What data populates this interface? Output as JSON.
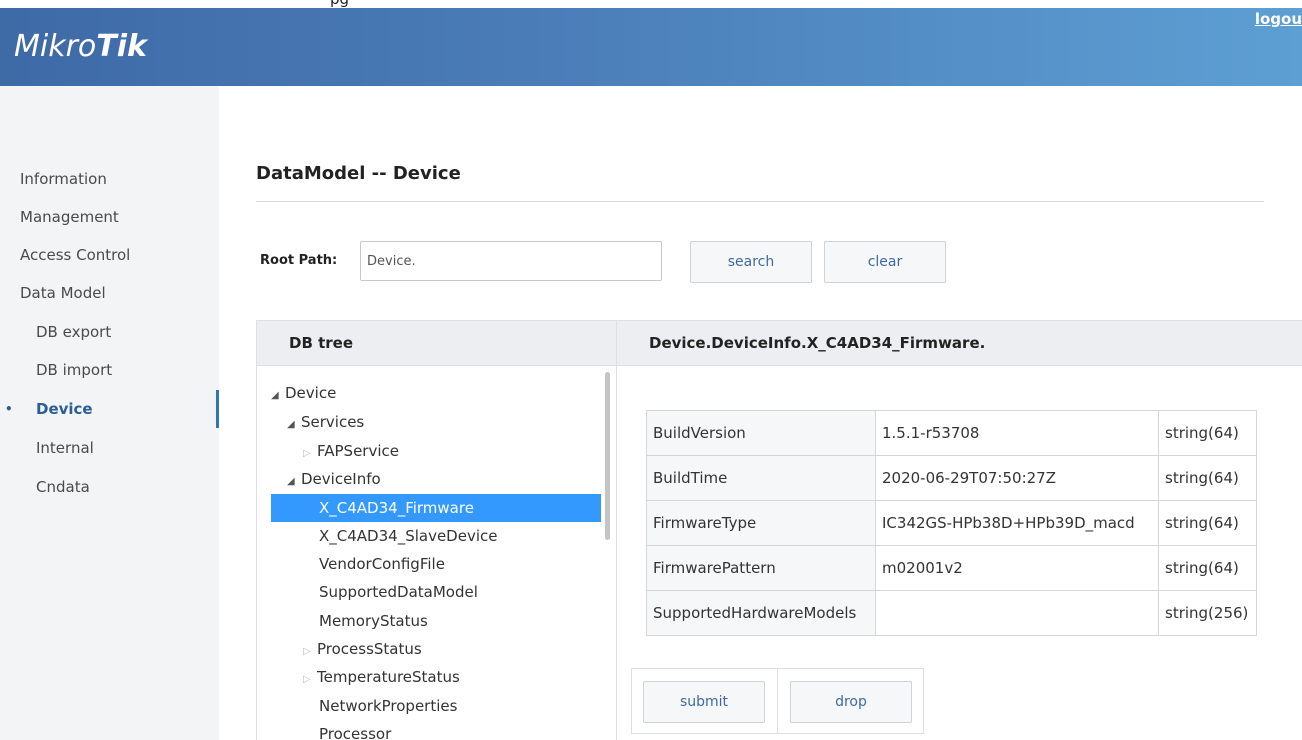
{
  "tab_stub": "pg",
  "header": {
    "logo_part1": "Mikro",
    "logo_part2": "Tik",
    "logout_label": "logou"
  },
  "sidebar": {
    "items": [
      {
        "label": "Information"
      },
      {
        "label": "Management"
      },
      {
        "label": "Access Control"
      },
      {
        "label": "Data Model"
      },
      {
        "label": "DB export"
      },
      {
        "label": "DB import"
      },
      {
        "label": "Device",
        "bullet": "•"
      },
      {
        "label": "Internal"
      },
      {
        "label": "Cndata"
      }
    ]
  },
  "main": {
    "title": "DataModel -- Device",
    "root_path_label": "Root Path:",
    "root_path_value": "Device.",
    "search_label": "search",
    "clear_label": "clear",
    "tree_header": "DB tree",
    "detail_header": "Device.DeviceInfo.X_C4AD34_Firmware.",
    "submit_label": "submit",
    "drop_label": "drop"
  },
  "tree": [
    {
      "label": "Device",
      "toggle": "◢"
    },
    {
      "label": "Services",
      "toggle": "◢"
    },
    {
      "label": "FAPService",
      "toggle": "▷"
    },
    {
      "label": "DeviceInfo",
      "toggle": "◢"
    },
    {
      "label": "X_C4AD34_Firmware"
    },
    {
      "label": "X_C4AD34_SlaveDevice"
    },
    {
      "label": "VendorConfigFile"
    },
    {
      "label": "SupportedDataModel"
    },
    {
      "label": "MemoryStatus"
    },
    {
      "label": "ProcessStatus",
      "toggle": "▷"
    },
    {
      "label": "TemperatureStatus",
      "toggle": "▷"
    },
    {
      "label": "NetworkProperties"
    },
    {
      "label": "Processor"
    }
  ],
  "params": [
    {
      "name": "BuildVersion",
      "value": "1.5.1-r53708",
      "type": "string(64)"
    },
    {
      "name": "BuildTime",
      "value": "2020-06-29T07:50:27Z",
      "type": "string(64)"
    },
    {
      "name": "FirmwareType",
      "value": "IC342GS-HPb38D+HPb39D_macd",
      "type": "string(64)"
    },
    {
      "name": "FirmwarePattern",
      "value": "m02001v2",
      "type": "string(64)"
    },
    {
      "name": "SupportedHardwareModels",
      "value": "",
      "type": "string(256)"
    }
  ]
}
